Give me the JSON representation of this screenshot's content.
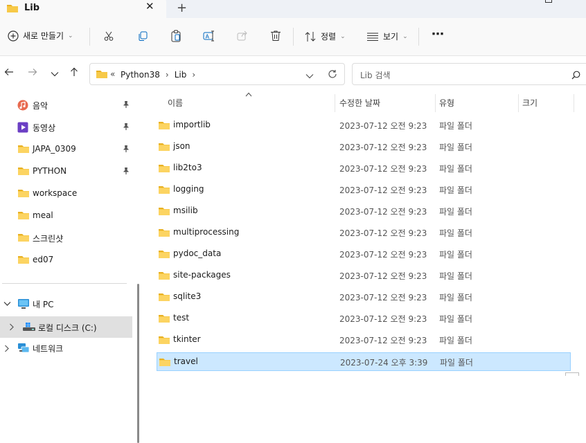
{
  "window": {
    "tab_title": "Lib",
    "close_glyph": "✕",
    "new_tab_glyph": "+"
  },
  "toolbar": {
    "new_label": "새로 만들기",
    "sort_label": "정렬",
    "view_label": "보기",
    "more_glyph": "⋯",
    "icons": [
      "cut-icon",
      "copy-icon",
      "paste-icon",
      "rename-icon",
      "share-icon",
      "delete-icon"
    ]
  },
  "address": {
    "overflow": "«",
    "crumbs": [
      "Python38",
      "Lib"
    ],
    "separator": "›",
    "search_placeholder": "Lib 검색"
  },
  "sidebar": {
    "quick": [
      {
        "label": "음악",
        "icon": "music-icon",
        "pinned": true
      },
      {
        "label": "동영상",
        "icon": "video-icon",
        "pinned": true
      },
      {
        "label": "JAPA_0309",
        "icon": "folder-icon",
        "pinned": true
      },
      {
        "label": "PYTHON",
        "icon": "folder-icon",
        "pinned": true
      },
      {
        "label": "workspace",
        "icon": "folder-icon",
        "pinned": false
      },
      {
        "label": "meal",
        "icon": "folder-icon",
        "pinned": false
      },
      {
        "label": "스크린샷",
        "icon": "folder-icon",
        "pinned": false
      },
      {
        "label": "ed07",
        "icon": "folder-icon",
        "pinned": false
      }
    ],
    "this_pc": "내 PC",
    "local_disk": "로컬 디스크 (C:)",
    "network": "네트워크"
  },
  "columns": {
    "name": "이름",
    "date": "수정한 날짜",
    "type": "유형",
    "size": "크기"
  },
  "files": [
    {
      "name": "importlib",
      "date": "2023-07-12 오전 9:23",
      "type": "파일 폴더"
    },
    {
      "name": "json",
      "date": "2023-07-12 오전 9:23",
      "type": "파일 폴더"
    },
    {
      "name": "lib2to3",
      "date": "2023-07-12 오전 9:23",
      "type": "파일 폴더"
    },
    {
      "name": "logging",
      "date": "2023-07-12 오전 9:23",
      "type": "파일 폴더"
    },
    {
      "name": "msilib",
      "date": "2023-07-12 오전 9:23",
      "type": "파일 폴더"
    },
    {
      "name": "multiprocessing",
      "date": "2023-07-12 오전 9:23",
      "type": "파일 폴더"
    },
    {
      "name": "pydoc_data",
      "date": "2023-07-12 오전 9:23",
      "type": "파일 폴더"
    },
    {
      "name": "site-packages",
      "date": "2023-07-12 오전 9:23",
      "type": "파일 폴더"
    },
    {
      "name": "sqlite3",
      "date": "2023-07-12 오전 9:23",
      "type": "파일 폴더"
    },
    {
      "name": "test",
      "date": "2023-07-12 오전 9:23",
      "type": "파일 폴더"
    },
    {
      "name": "tkinter",
      "date": "2023-07-12 오전 9:23",
      "type": "파일 폴더"
    },
    {
      "name": "travel",
      "date": "2023-07-24 오후 3:39",
      "type": "파일 폴더",
      "selected": true
    }
  ],
  "colors": {
    "folder": "#f7c948",
    "folder_dark": "#e8b022",
    "selection": "#cce8ff",
    "accent": "#0067c0"
  }
}
